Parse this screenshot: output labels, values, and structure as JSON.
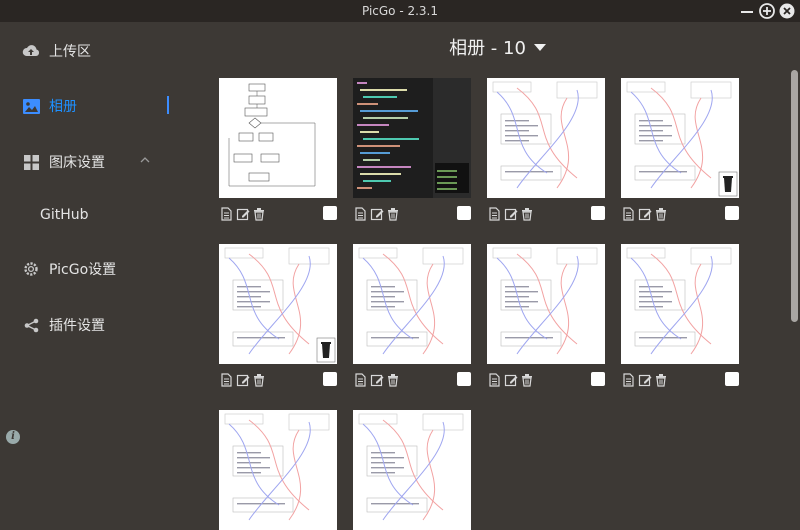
{
  "window": {
    "title": "PicGo - 2.3.1"
  },
  "sidebar": {
    "items": [
      {
        "label": "上传区",
        "icon": "cloud-upload-icon"
      },
      {
        "label": "相册",
        "icon": "image-icon",
        "active": true
      },
      {
        "label": "图床设置",
        "icon": "grid-icon"
      },
      {
        "label": "GitHub"
      },
      {
        "label": "PicGo设置",
        "icon": "gear-icon"
      },
      {
        "label": "插件设置",
        "icon": "share-icon"
      }
    ]
  },
  "gallery": {
    "title": "相册 - 10",
    "count": 10,
    "images": [
      {
        "kind": "flowchart"
      },
      {
        "kind": "code-dark"
      },
      {
        "kind": "diagram"
      },
      {
        "kind": "diagram-trash"
      },
      {
        "kind": "diagram-trash"
      },
      {
        "kind": "diagram"
      },
      {
        "kind": "diagram"
      },
      {
        "kind": "diagram"
      },
      {
        "kind": "diagram-partial"
      },
      {
        "kind": "diagram-partial"
      }
    ]
  },
  "colors": {
    "accent": "#3c8dff",
    "background": "#3d3935",
    "titlebar": "#2a2623"
  }
}
